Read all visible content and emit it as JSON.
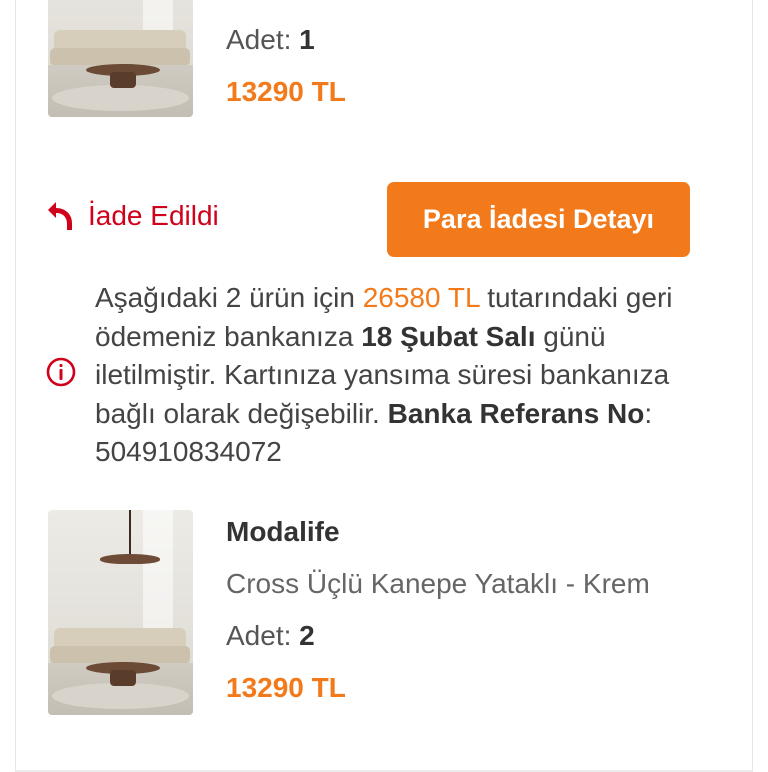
{
  "top_item": {
    "quantity_label": "Adet:",
    "quantity_value": "1",
    "price": "13290 TL"
  },
  "refund": {
    "status_label": "İade Edildi",
    "detail_button_label": "Para İadesi Detayı",
    "message": {
      "part1": "Aşağıdaki 2 ürün için ",
      "amount": "26580 TL",
      "part2": " tutarındaki geri ödemeniz bankanıza ",
      "date": "18 Şubat Salı",
      "part3": " günü iletilmiştir. Kartınıza yansıma süresi bankanıza bağlı olarak değişebilir. ",
      "ref_label": "Banka Referans No",
      "ref_sep": ": ",
      "ref_number": "504910834072"
    },
    "item": {
      "brand": "Modalife",
      "name": "Cross Üçlü Kanepe Yataklı - Krem",
      "quantity_label": "Adet:",
      "quantity_value": "2",
      "price": "13290 TL"
    }
  },
  "colors": {
    "accent": "#f27a1a",
    "status_red": "#d0021b"
  },
  "icons": [
    "return-arrow-icon",
    "info-circle-icon"
  ]
}
